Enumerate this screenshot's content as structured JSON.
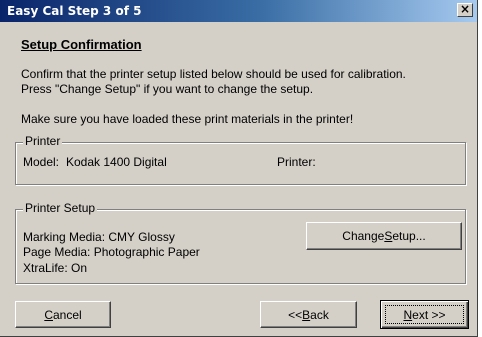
{
  "window": {
    "title": "Easy Cal Step 3 of 5",
    "close_glyph": "×"
  },
  "header": {
    "title": "Setup Confirmation"
  },
  "instructions": {
    "line1": "Confirm that the printer setup listed below should be used for calibration.",
    "line2": "Press \"Change Setup\" if you want to change the setup.",
    "line3": "Make sure you have loaded these print materials in the printer!"
  },
  "printer_group": {
    "label": "Printer",
    "model_label": "Model:",
    "model_value": "Kodak 1400 Digital",
    "printer_label": "Printer:",
    "printer_value": ""
  },
  "setup_group": {
    "label": "Printer Setup",
    "marking_media": "Marking Media: CMY Glossy",
    "page_media": "Page Media: Photographic Paper",
    "xtralife": "XtraLife: On",
    "change_button_pre": "Change ",
    "change_button_accel": "S",
    "change_button_post": "etup..."
  },
  "footer": {
    "cancel_accel": "C",
    "cancel_rest": "ancel",
    "back_pre": "<< ",
    "back_accel": "B",
    "back_rest": "ack",
    "next_accel": "N",
    "next_rest": "ext >>"
  },
  "colors": {
    "titlebar_start": "#0a246a",
    "titlebar_end": "#a6caf0",
    "dialog_face": "#d4d0c8"
  }
}
